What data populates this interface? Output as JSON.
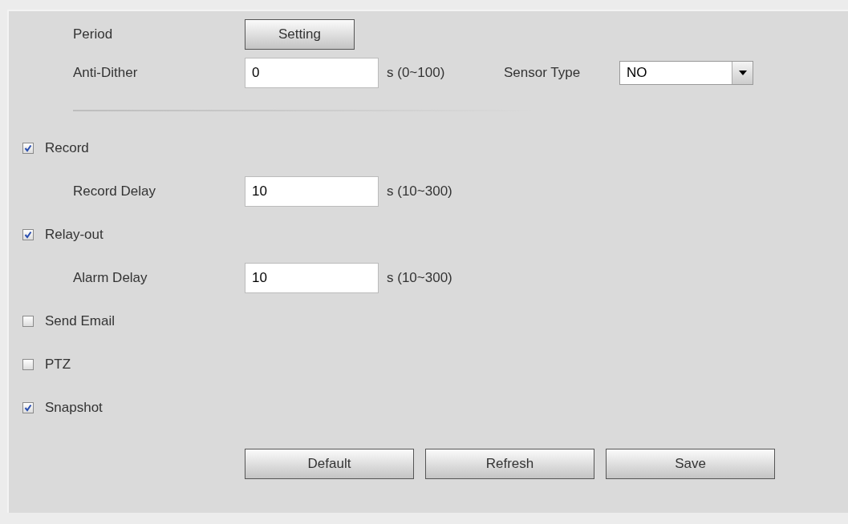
{
  "rows": [
    {
      "kind": "button",
      "label": "Period",
      "button": "Setting"
    },
    {
      "kind": "input",
      "label": "Anti-Dither",
      "value": "0",
      "unit": "s (0~100)",
      "extra": {
        "label": "Sensor Type",
        "value": "NO"
      }
    },
    {
      "kind": "divider"
    },
    {
      "kind": "checkbox",
      "label": "Record",
      "checked": true
    },
    {
      "kind": "input",
      "label": "Record Delay",
      "value": "10",
      "unit": "s (10~300)"
    },
    {
      "kind": "checkbox",
      "label": "Relay-out",
      "checked": true
    },
    {
      "kind": "input",
      "label": "Alarm Delay",
      "value": "10",
      "unit": "s (10~300)"
    },
    {
      "kind": "checkbox",
      "label": "Send Email",
      "checked": false
    },
    {
      "kind": "checkbox",
      "label": "PTZ",
      "checked": false
    },
    {
      "kind": "checkbox",
      "label": "Snapshot",
      "checked": true
    }
  ],
  "buttons": [
    "Default",
    "Refresh",
    "Save"
  ]
}
